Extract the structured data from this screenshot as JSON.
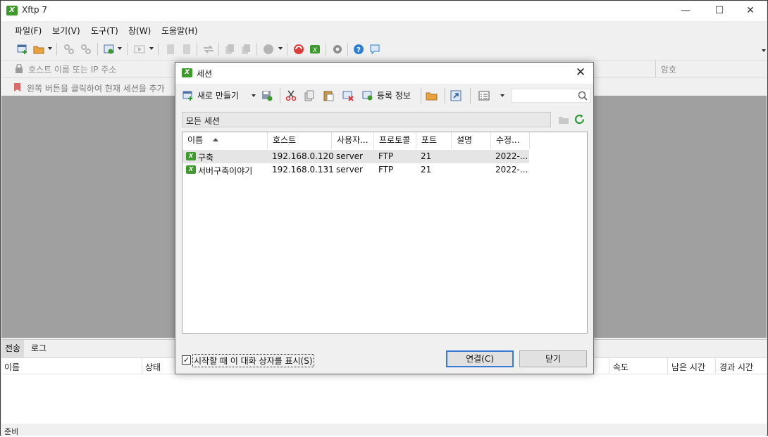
{
  "app": {
    "title": "Xftp 7"
  },
  "window_controls": {
    "minimize": "—",
    "maximize": "☐",
    "close": "✕"
  },
  "menu": [
    "파일(F)",
    "보기(V)",
    "도구(T)",
    "창(W)",
    "도움말(H)"
  ],
  "address_bar": {
    "host_placeholder": "호스트 이름 또는 IP 주소",
    "password_label": "암호"
  },
  "hint": "왼쪽 버튼을 클릭하여 현재 세션을 추가",
  "bottom_tabs": [
    "전송",
    "로그"
  ],
  "transfer_columns": [
    "이름",
    "상태",
    "속도",
    "남은 시간",
    "경과 시간"
  ],
  "status": "준비",
  "dialog": {
    "title": "세션",
    "toolbar": {
      "new_label": "새로 만들기",
      "properties_label": "등록 정보"
    },
    "path": "모든 세션",
    "columns": [
      "이름",
      "호스트",
      "사용자...",
      "프로토콜",
      "포트",
      "설명",
      "수정..."
    ],
    "sessions": [
      {
        "name": "구축",
        "host": "192.168.0.120",
        "user": "server",
        "protocol": "FTP",
        "port": "21",
        "desc": "",
        "modified": "2022-..."
      },
      {
        "name": "서버구축이야기",
        "host": "192.168.0.131",
        "user": "server",
        "protocol": "FTP",
        "port": "21",
        "desc": "",
        "modified": "2022-..."
      }
    ],
    "show_at_startup": "시작할 때 이 대화 상자를 표시(S)",
    "show_at_startup_checked": true,
    "connect_label": "연결(C)",
    "close_label": "닫기"
  },
  "colors": {
    "brand_green": "#3e9a2c",
    "workspace_gray": "#a0a0a0",
    "default_button_border": "#3a7bd5"
  }
}
